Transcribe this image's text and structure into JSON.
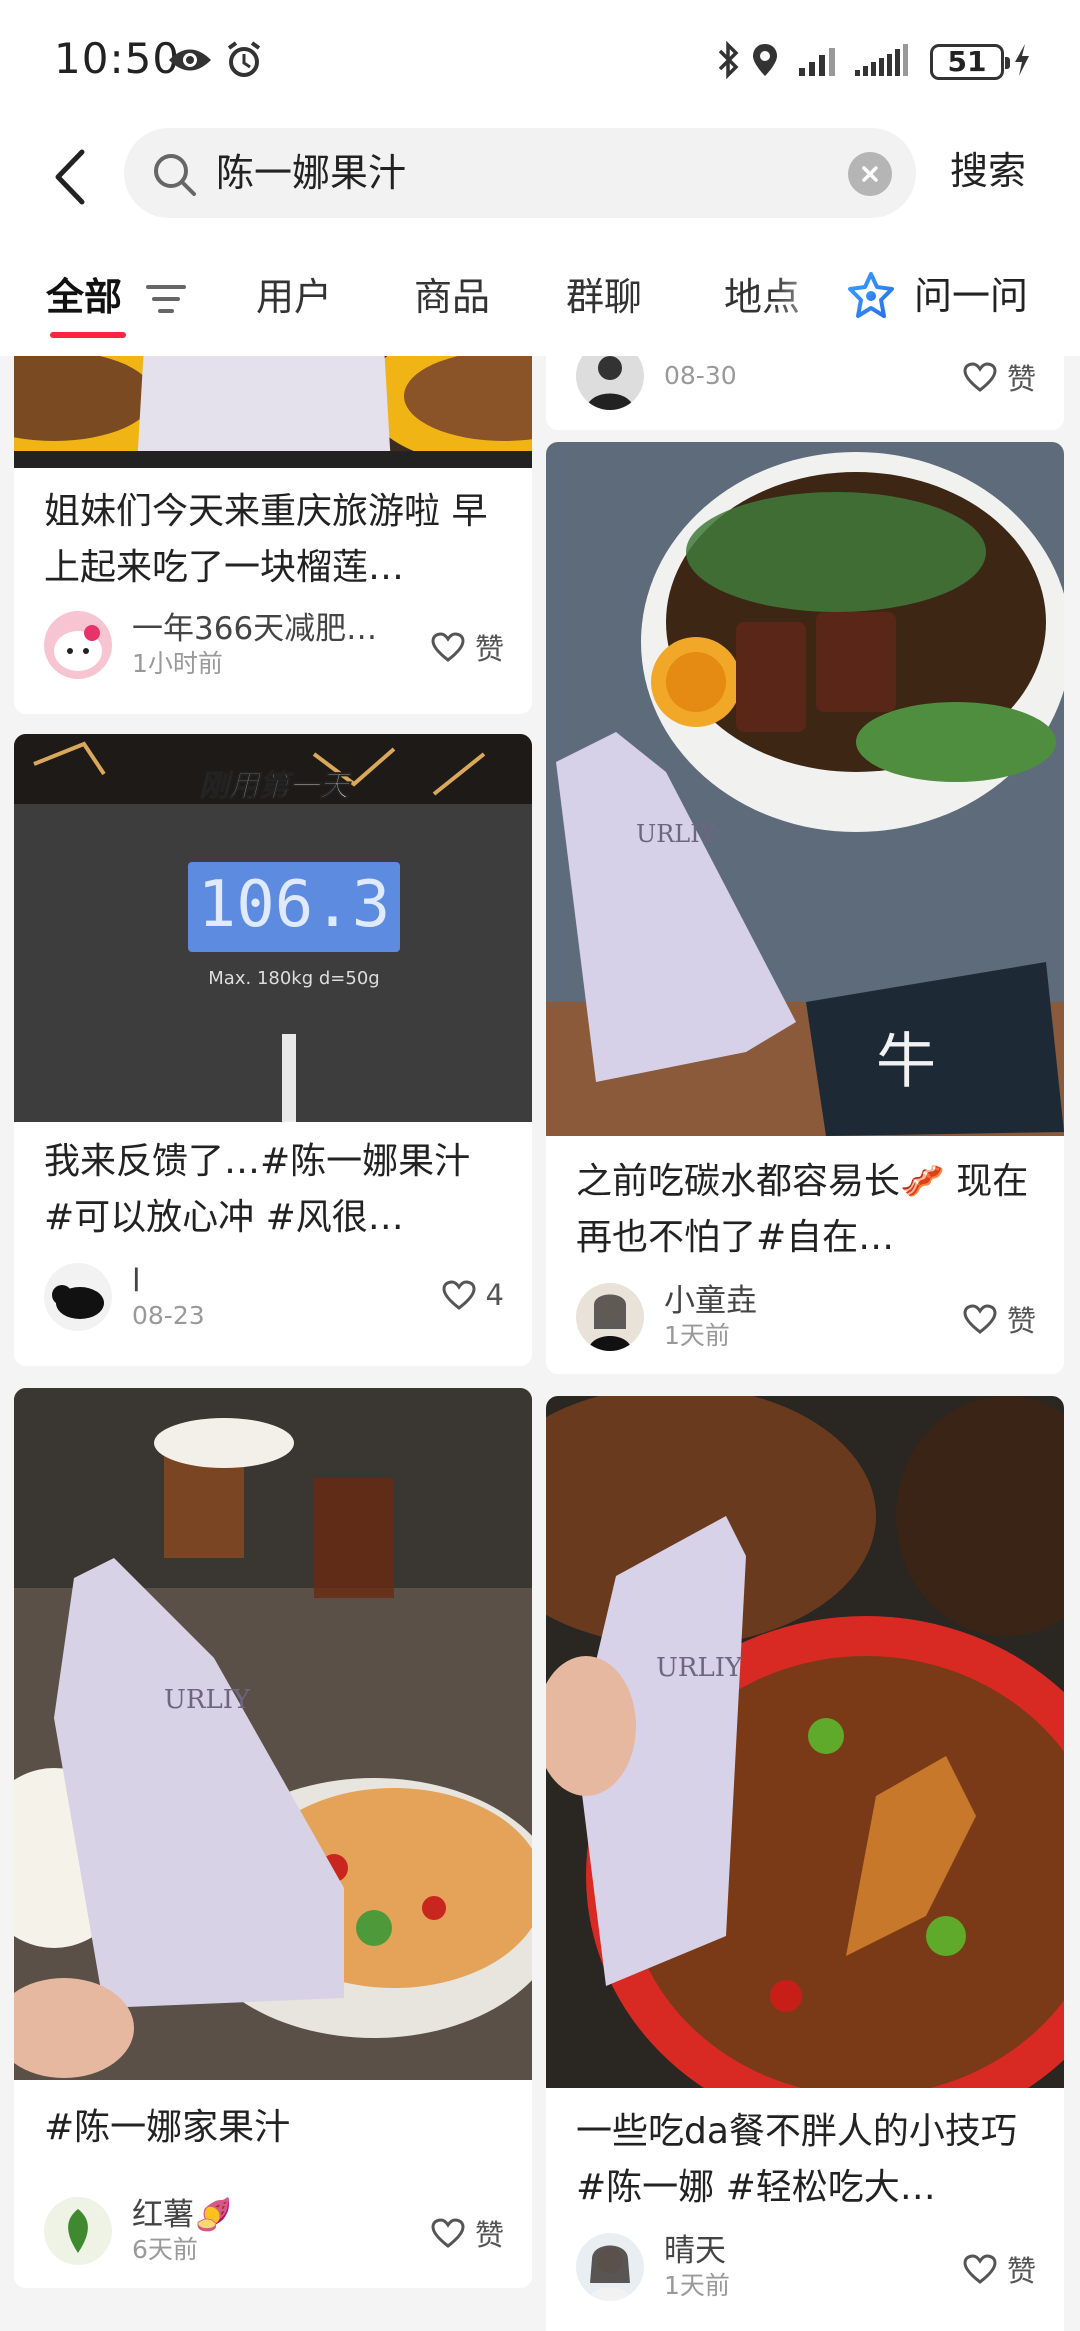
{
  "status_bar": {
    "time": "10:50",
    "battery": "51"
  },
  "search": {
    "query": "陈一娜果汁",
    "search_button": "搜索"
  },
  "tabs": [
    {
      "label": "全部"
    },
    {
      "label": "用户"
    },
    {
      "label": "商品"
    },
    {
      "label": "群聊"
    },
    {
      "label": "地点"
    }
  ],
  "ask_button": "问一问",
  "feed": {
    "left_column": [
      {
        "title": "姐妹们今天来重庆旅游啦 早上起来吃了一块榴莲…",
        "author": "一年366天减肥…",
        "time": "1小时前",
        "likes": "赞"
      },
      {
        "image_caption": "刚用第一天",
        "scale_reading": "106.3",
        "scale_label": "Max. 180kg d=50g",
        "title": "我来反馈了…#陈一娜果汁 #可以放心冲 #风很…",
        "author": "l",
        "time": "08-23",
        "likes": "4"
      },
      {
        "pouch_brand": "URLIY",
        "title": "#陈一娜家果汁",
        "author": "红薯🍠",
        "time": "6天前",
        "likes": "赞"
      }
    ],
    "right_column": [
      {
        "author": "",
        "time": "08-30",
        "likes": "赞"
      },
      {
        "pouch_brand": "URLIY",
        "title": "之前吃碳水都容易长🥓 现在再也不怕了#自在…",
        "author": "小童垚",
        "time": "1天前",
        "likes": "赞"
      },
      {
        "pouch_brand": "URLIY",
        "title": "一些吃da餐不胖人的小技巧 #陈一娜 #轻松吃大…",
        "author": "晴天",
        "time": "1天前",
        "likes": "赞"
      }
    ]
  }
}
